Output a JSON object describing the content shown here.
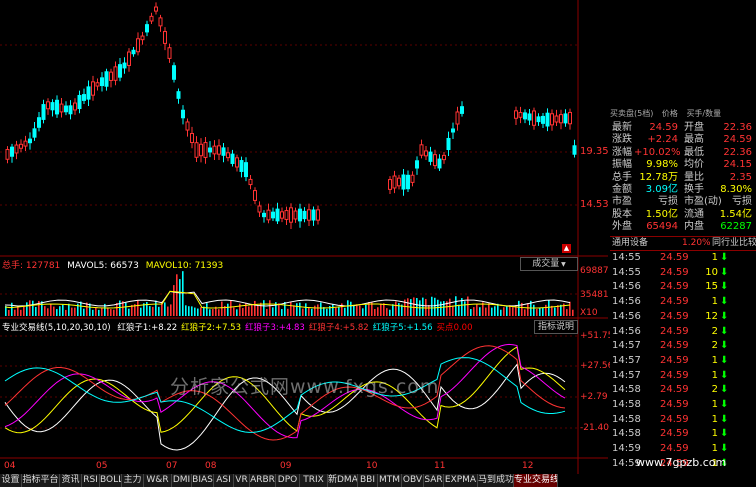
{
  "price_axis": [
    "19.35",
    "14.53"
  ],
  "volume_legend": {
    "total_label": "总手:",
    "total_value": "127781",
    "mavol5_label": "MAVOL5:",
    "mavol5_value": "66573",
    "mavol10_label": "MAVOL10:",
    "mavol10_value": "71393",
    "dropdown": "成交量"
  },
  "volume_axis": [
    "69887",
    "35481",
    "X10"
  ],
  "indicator_legend": {
    "name": "专业交易线(5,10,20,30,10)",
    "items": [
      {
        "label": "红狼子1:",
        "value": "+8.22",
        "color": "#ffffff"
      },
      {
        "label": "红狼子2:",
        "value": "+7.53",
        "color": "#ffff00"
      },
      {
        "label": "红狼子3:",
        "value": "+4.83",
        "color": "#ff00ff"
      },
      {
        "label": "红狼子4:",
        "value": "+5.82",
        "color": "#ff3333"
      },
      {
        "label": "红狼子5:",
        "value": "+1.56",
        "color": "#00ffff"
      },
      {
        "label": "买点",
        "value": "0.00",
        "color": "#ff0000"
      }
    ],
    "help": "指标说明"
  },
  "indicator_axis": [
    "+51.75",
    "+27.56",
    "+2.79",
    "-21.40"
  ],
  "months": [
    "04",
    "05",
    "07",
    "08",
    "09",
    "10",
    "11",
    "12"
  ],
  "watermark": "分析家公式网www.fxgs.com",
  "watermark_bottom": "www.7gpzb.com",
  "right_panel": {
    "header_left": "买卖盘(5档)",
    "header_mid": "价格",
    "header_right": "买手/数量",
    "quotes": [
      {
        "l1": "最新",
        "v1": "24.59",
        "l2": "开盘",
        "v2": "22.36",
        "c1": "#ff3333",
        "c2": "#ff3333"
      },
      {
        "l1": "涨跌",
        "v1": "+2.24",
        "l2": "最高",
        "v2": "24.59",
        "c1": "#ff3333",
        "c2": "#ff3333"
      },
      {
        "l1": "涨幅",
        "v1": "+10.02%",
        "l2": "最低",
        "v2": "22.36",
        "c1": "#ff3333",
        "c2": "#ff3333"
      },
      {
        "l1": "振幅",
        "v1": "9.98%",
        "l2": "均价",
        "v2": "24.15",
        "c1": "#ffff00",
        "c2": "#ff3333"
      },
      {
        "l1": "总手",
        "v1": "12.78万",
        "l2": "量比",
        "v2": "2.35",
        "c1": "#ffff00",
        "c2": "#ff3333"
      },
      {
        "l1": "金额",
        "v1": "3.09亿",
        "l2": "换手",
        "v2": "8.30%",
        "c1": "#00ffff",
        "c2": "#ffff00"
      },
      {
        "l1": "市盈",
        "v1": "亏损",
        "l2": "市盈(动)",
        "v2": "亏损",
        "c1": "#ccc",
        "c2": "#ccc"
      },
      {
        "l1": "股本",
        "v1": "1.50亿",
        "l2": "流通",
        "v2": "1.54亿",
        "c1": "#ffff00",
        "c2": "#ffff00"
      },
      {
        "l1": "外盘",
        "v1": "65494",
        "l2": "内盘",
        "v2": "62287",
        "c1": "#ff3333",
        "c2": "#00ff00"
      }
    ],
    "sector_label": "通用设备",
    "sector_pct": "1.20%",
    "sector_compare": "同行业比较",
    "ticks": [
      {
        "time": "14:55",
        "price": "24.59",
        "vol": "1",
        "arrow": "down"
      },
      {
        "time": "14:55",
        "price": "24.59",
        "vol": "10",
        "arrow": "down"
      },
      {
        "time": "14:56",
        "price": "24.59",
        "vol": "15",
        "arrow": "down"
      },
      {
        "time": "14:56",
        "price": "24.59",
        "vol": "1",
        "arrow": "down"
      },
      {
        "time": "14:56",
        "price": "24.59",
        "vol": "12",
        "arrow": "down"
      },
      {
        "time": "14:56",
        "price": "24.59",
        "vol": "2",
        "arrow": "down"
      },
      {
        "time": "14:57",
        "price": "24.59",
        "vol": "2",
        "arrow": "down"
      },
      {
        "time": "14:57",
        "price": "24.59",
        "vol": "1",
        "arrow": "down"
      },
      {
        "time": "14:57",
        "price": "24.59",
        "vol": "1",
        "arrow": "down"
      },
      {
        "time": "14:58",
        "price": "24.59",
        "vol": "2",
        "arrow": "down"
      },
      {
        "time": "14:58",
        "price": "24.59",
        "vol": "1",
        "arrow": "down"
      },
      {
        "time": "14:58",
        "price": "24.59",
        "vol": "1",
        "arrow": "down"
      },
      {
        "time": "14:58",
        "price": "24.59",
        "vol": "1",
        "arrow": "down"
      },
      {
        "time": "14:59",
        "price": "24.59",
        "vol": "1",
        "arrow": "down"
      },
      {
        "time": "14:59",
        "price": "24.59",
        "vol": "1",
        "arrow": "down"
      }
    ]
  },
  "tabs": [
    "设置",
    "指标平台",
    "资讯",
    "RSI",
    "BOLL",
    "主力",
    "W&R",
    "DMI",
    "BIAS",
    "ASI",
    "VR",
    "ARBR",
    "DPO",
    "TRIX",
    "新DMA",
    "BBI",
    "MTM",
    "OBV",
    "SAR",
    "EXPMA",
    "马到成功",
    "专业交易线"
  ],
  "active_tab": "专业交易线",
  "colors": {
    "up": "#ff3333",
    "down": "#00ffff",
    "grid": "#8b0000",
    "text_yellow": "#ffff00"
  }
}
